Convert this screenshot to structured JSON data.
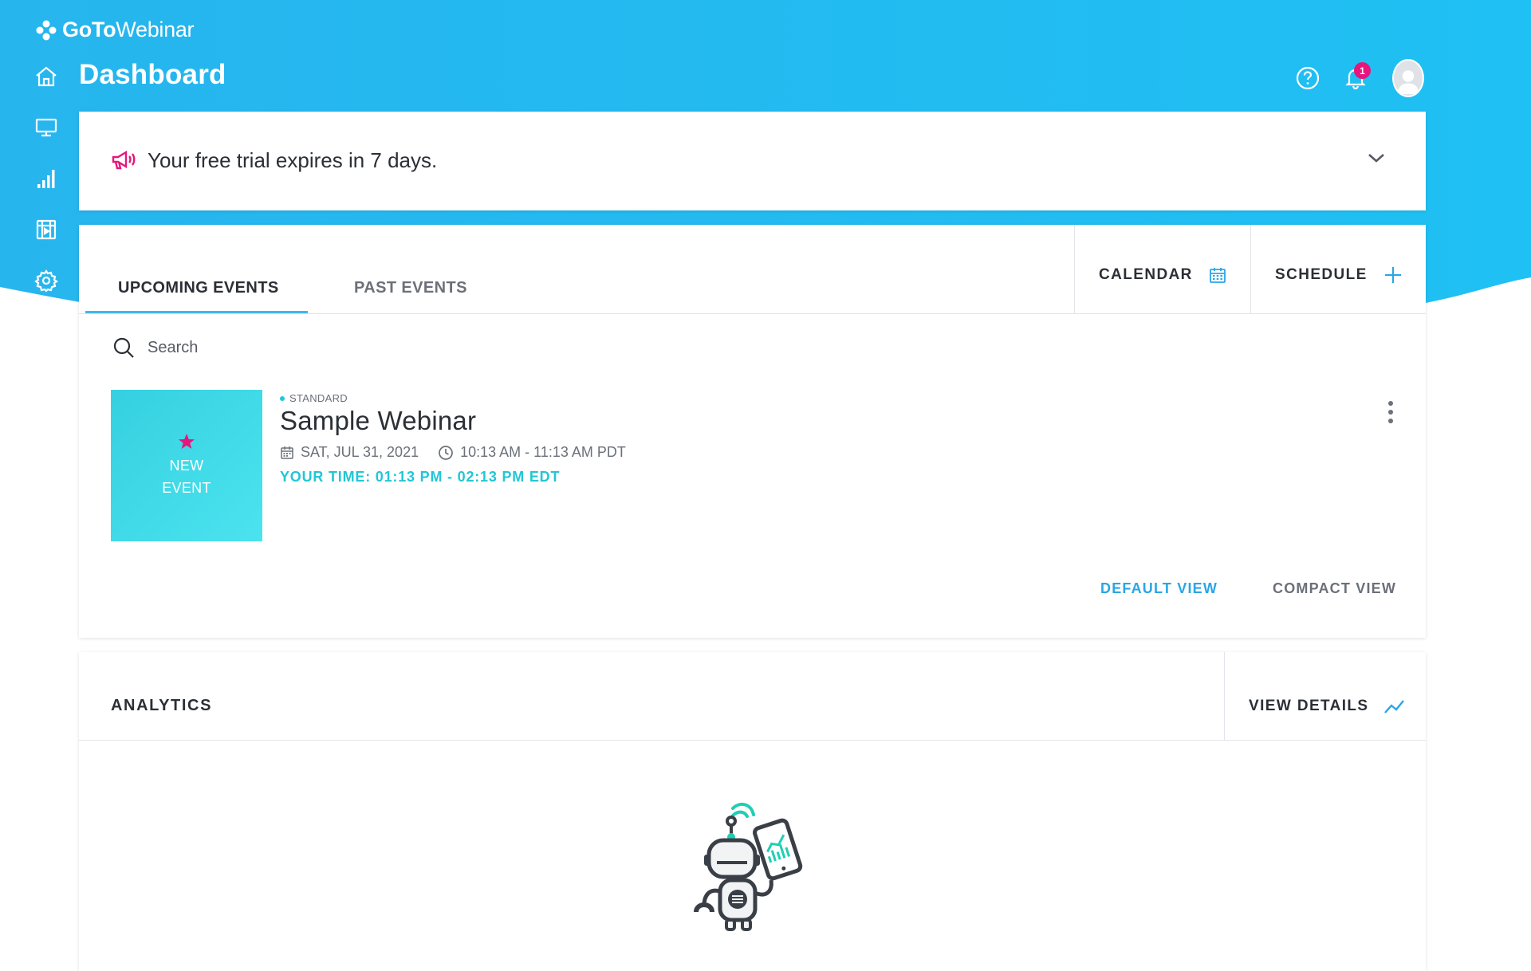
{
  "app": {
    "logo_bold": "GoTo",
    "logo_light": "Webinar"
  },
  "header": {
    "title": "Dashboard",
    "notification_count": "1"
  },
  "icons": {
    "nav": [
      "home-icon",
      "monitor-icon",
      "bar-chart-icon",
      "recordings-icon",
      "gear-icon"
    ],
    "help": "help-circle-icon",
    "bell": "bell-icon",
    "avatar": "user-avatar-icon",
    "megaphone": "megaphone-icon",
    "chevron": "chevron-down-icon",
    "calendar": "calendar-icon",
    "plus": "plus-icon",
    "search": "search-icon",
    "star": "star-icon",
    "clock": "clock-icon",
    "kebab": "more-vertical-icon",
    "trend": "trend-line-icon",
    "robot": "robot-illustration"
  },
  "colors": {
    "brand_blue": "#27b5ee",
    "accent_pink": "#e8157c",
    "teal": "#22c6d6",
    "link_blue": "#2aa6e5"
  },
  "trial_banner": {
    "text": "Your free trial expires in 7 days."
  },
  "events": {
    "tabs": [
      {
        "label": "UPCOMING EVENTS",
        "active": true
      },
      {
        "label": "PAST EVENTS",
        "active": false
      }
    ],
    "calendar_label": "CALENDAR",
    "schedule_label": "SCHEDULE",
    "search_placeholder": "Search",
    "items": [
      {
        "thumb_line1": "NEW",
        "thumb_line2": "EVENT",
        "type": "STANDARD",
        "title": "Sample Webinar",
        "date": "SAT, JUL 31, 2021",
        "time": "10:13 AM - 11:13 AM PDT",
        "your_time": "YOUR TIME: 01:13 PM - 02:13 PM EDT"
      }
    ],
    "view_default": "DEFAULT VIEW",
    "view_compact": "COMPACT VIEW"
  },
  "analytics": {
    "title": "ANALYTICS",
    "details_label": "VIEW DETAILS"
  }
}
